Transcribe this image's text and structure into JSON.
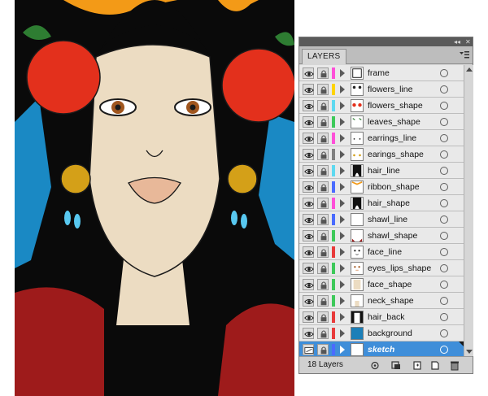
{
  "panel": {
    "tab_label": "LAYERS",
    "collapse_glyph": "◂◂",
    "close_glyph": "✕",
    "layer_count": "18 Layers"
  },
  "colors": {
    "selection": "#3f8ed9",
    "panel_bg": "#d6d6d6",
    "row_bg": "#e9e9e9"
  },
  "layers": [
    {
      "name": "frame",
      "color": "#ff4fd8",
      "thumb": "frame"
    },
    {
      "name": "flowers_line",
      "color": "#ffd400",
      "thumb": "flowers_line"
    },
    {
      "name": "flowers_shape",
      "color": "#5ed9f0",
      "thumb": "flowers_shape"
    },
    {
      "name": "leaves_shape",
      "color": "#3ec95a",
      "thumb": "leaves"
    },
    {
      "name": "earrings_line",
      "color": "#ff4fd8",
      "thumb": "dots"
    },
    {
      "name": "earings_shape",
      "color": "#808080",
      "thumb": "earrings"
    },
    {
      "name": "hair_line",
      "color": "#5ed9f0",
      "thumb": "hair"
    },
    {
      "name": "ribbon_shape",
      "color": "#4a6bff",
      "thumb": "ribbon"
    },
    {
      "name": "hair_shape",
      "color": "#ff4fd8",
      "thumb": "hair"
    },
    {
      "name": "shawl_line",
      "color": "#4a6bff",
      "thumb": "blank"
    },
    {
      "name": "shawl_shape",
      "color": "#3ec95a",
      "thumb": "shawl"
    },
    {
      "name": "face_line",
      "color": "#e83a3a",
      "thumb": "face"
    },
    {
      "name": "eyes_lips_shape",
      "color": "#3ec95a",
      "thumb": "eyes"
    },
    {
      "name": "face_shape",
      "color": "#3ec95a",
      "thumb": "skin"
    },
    {
      "name": "neck_shape",
      "color": "#3ec95a",
      "thumb": "neck"
    },
    {
      "name": "hair_back",
      "color": "#e83a3a",
      "thumb": "hair_back"
    },
    {
      "name": "background",
      "color": "#e83a3a",
      "thumb": "bg"
    },
    {
      "name": "sketch",
      "color": "#4a6bff",
      "thumb": "blank",
      "selected": true
    }
  ]
}
